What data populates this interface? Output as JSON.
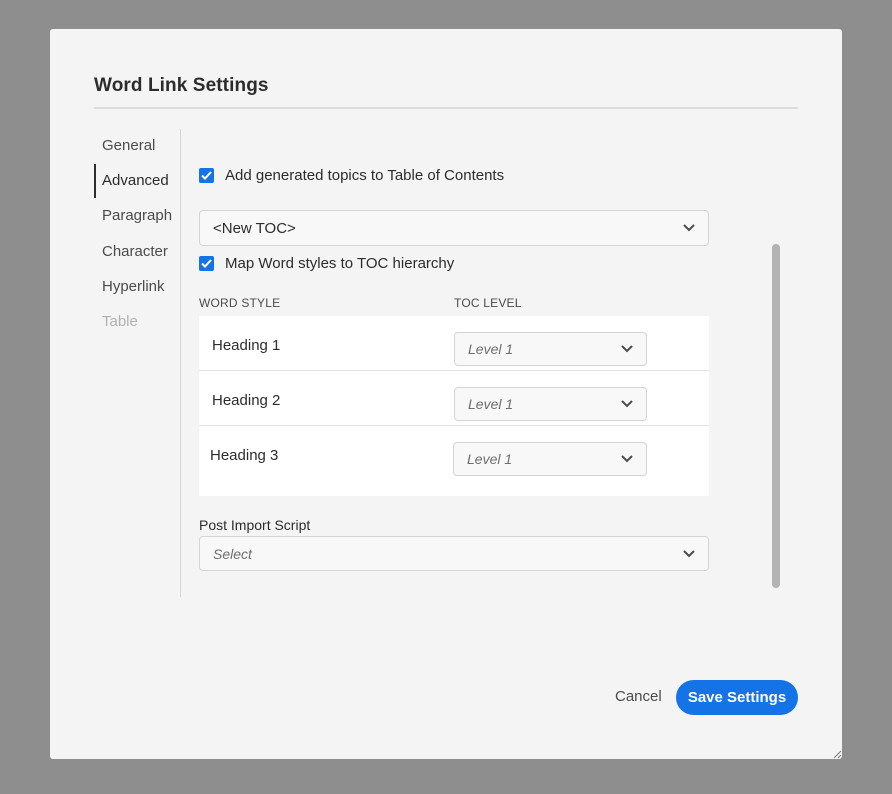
{
  "dialog": {
    "title": "Word Link Settings"
  },
  "sidebar": {
    "items": [
      {
        "label": "General",
        "state": "normal"
      },
      {
        "label": "Advanced",
        "state": "active"
      },
      {
        "label": "Paragraph",
        "state": "normal"
      },
      {
        "label": "Character",
        "state": "normal"
      },
      {
        "label": "Hyperlink",
        "state": "normal"
      },
      {
        "label": "Table",
        "state": "disabled"
      }
    ]
  },
  "advanced": {
    "add_to_toc": {
      "label": "Add generated topics to Table of Contents",
      "checked": true
    },
    "toc_select": {
      "value": "<New TOC>"
    },
    "map_styles": {
      "label": "Map Word styles to TOC hierarchy",
      "checked": true
    },
    "columns": {
      "word_style": "WORD STYLE",
      "toc_level": "TOC LEVEL"
    },
    "mappings": [
      {
        "style": "Heading 1",
        "level": "Level 1"
      },
      {
        "style": "Heading 2",
        "level": "Level 1"
      },
      {
        "style": "Heading 3",
        "level": "Level 1"
      }
    ],
    "post_import_script": {
      "label": "Post Import Script",
      "placeholder": "Select"
    }
  },
  "footer": {
    "cancel_label": "Cancel",
    "save_label": "Save Settings"
  },
  "colors": {
    "accent": "#1473e6",
    "backdrop": "#8e8e8e",
    "dialog_bg": "#f4f4f4"
  }
}
